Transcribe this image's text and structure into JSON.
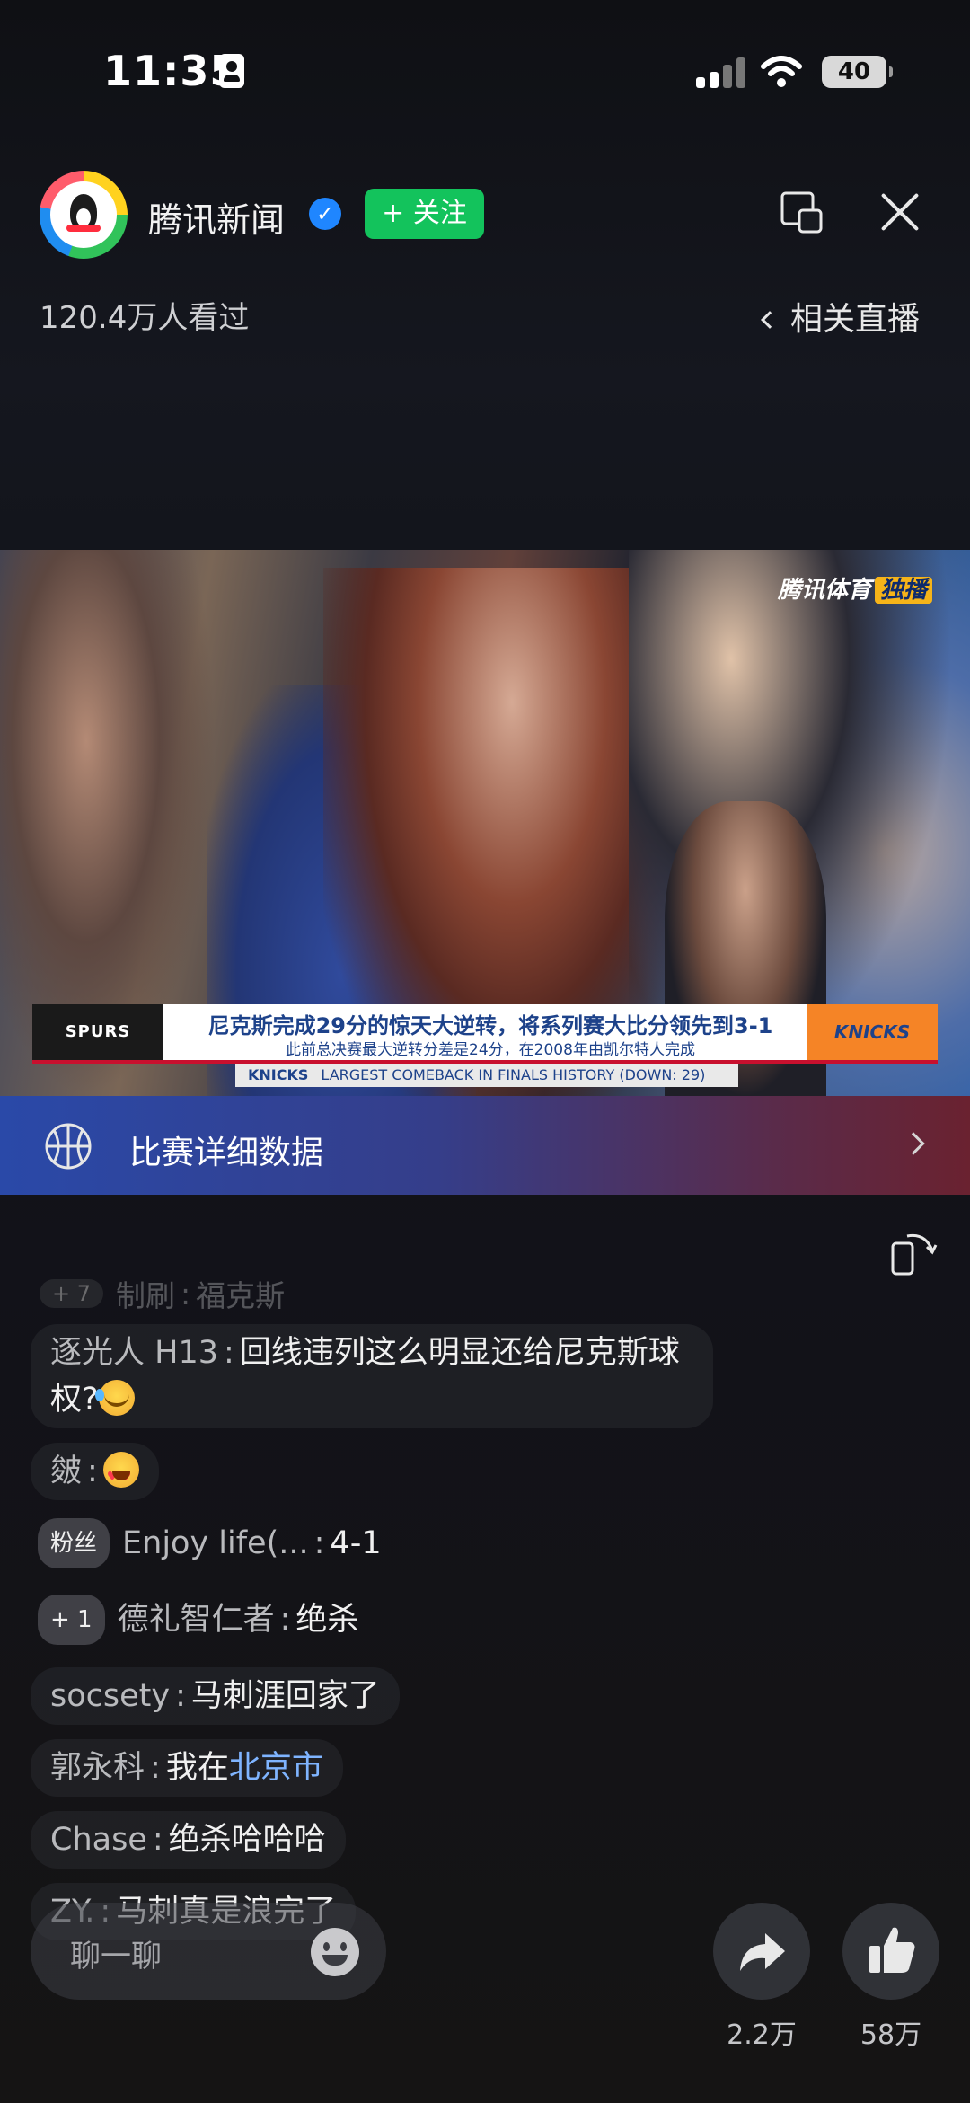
{
  "status_bar": {
    "time": "11:35",
    "battery": "40"
  },
  "header": {
    "account_name": "腾讯新闻",
    "follow_label": "+ 关注",
    "views": "120.4万人看过",
    "related_live": "相关直播"
  },
  "video": {
    "watermark": "腾讯体育",
    "watermark_tag": "独播",
    "banner_main": "尼克斯完成29分的惊天大逆转，将系列赛大比分领先到3-1",
    "banner_sub": "此前总决赛最大逆转分差是24分，在2008年由凯尔特人完成",
    "left_team": "SPURS",
    "right_team": "KNICKS",
    "strip_team": "KNICKS",
    "strip_text": "LARGEST COMEBACK IN FINALS HISTORY (DOWN: 29)"
  },
  "stats_bar": {
    "label": "比赛详细数据"
  },
  "comments": {
    "faded": {
      "level": "+ 7",
      "user": "制刷",
      "text": "福克斯"
    },
    "items": [
      {
        "user": "逐光人 H13",
        "text": "回线违列这么明显还给尼克斯球权?"
      },
      {
        "user": "皴",
        "text": ""
      },
      {
        "tag": "粉丝",
        "user": "Enjoy life(...",
        "text": "4-1"
      },
      {
        "tag": "+ 1",
        "user": "德礼智仁者",
        "text": "绝杀"
      },
      {
        "user": "socsety",
        "text": "马刺涯回家了"
      },
      {
        "user": "郭永科",
        "text": "我在",
        "location": "北京市"
      },
      {
        "user": "Chase",
        "text": "绝杀哈哈哈"
      },
      {
        "user": "ZY.",
        "text": "马刺真是浪完了"
      }
    ]
  },
  "bottom": {
    "chat_placeholder": "聊一聊",
    "share_count": "2.2万",
    "like_count": "58万"
  }
}
